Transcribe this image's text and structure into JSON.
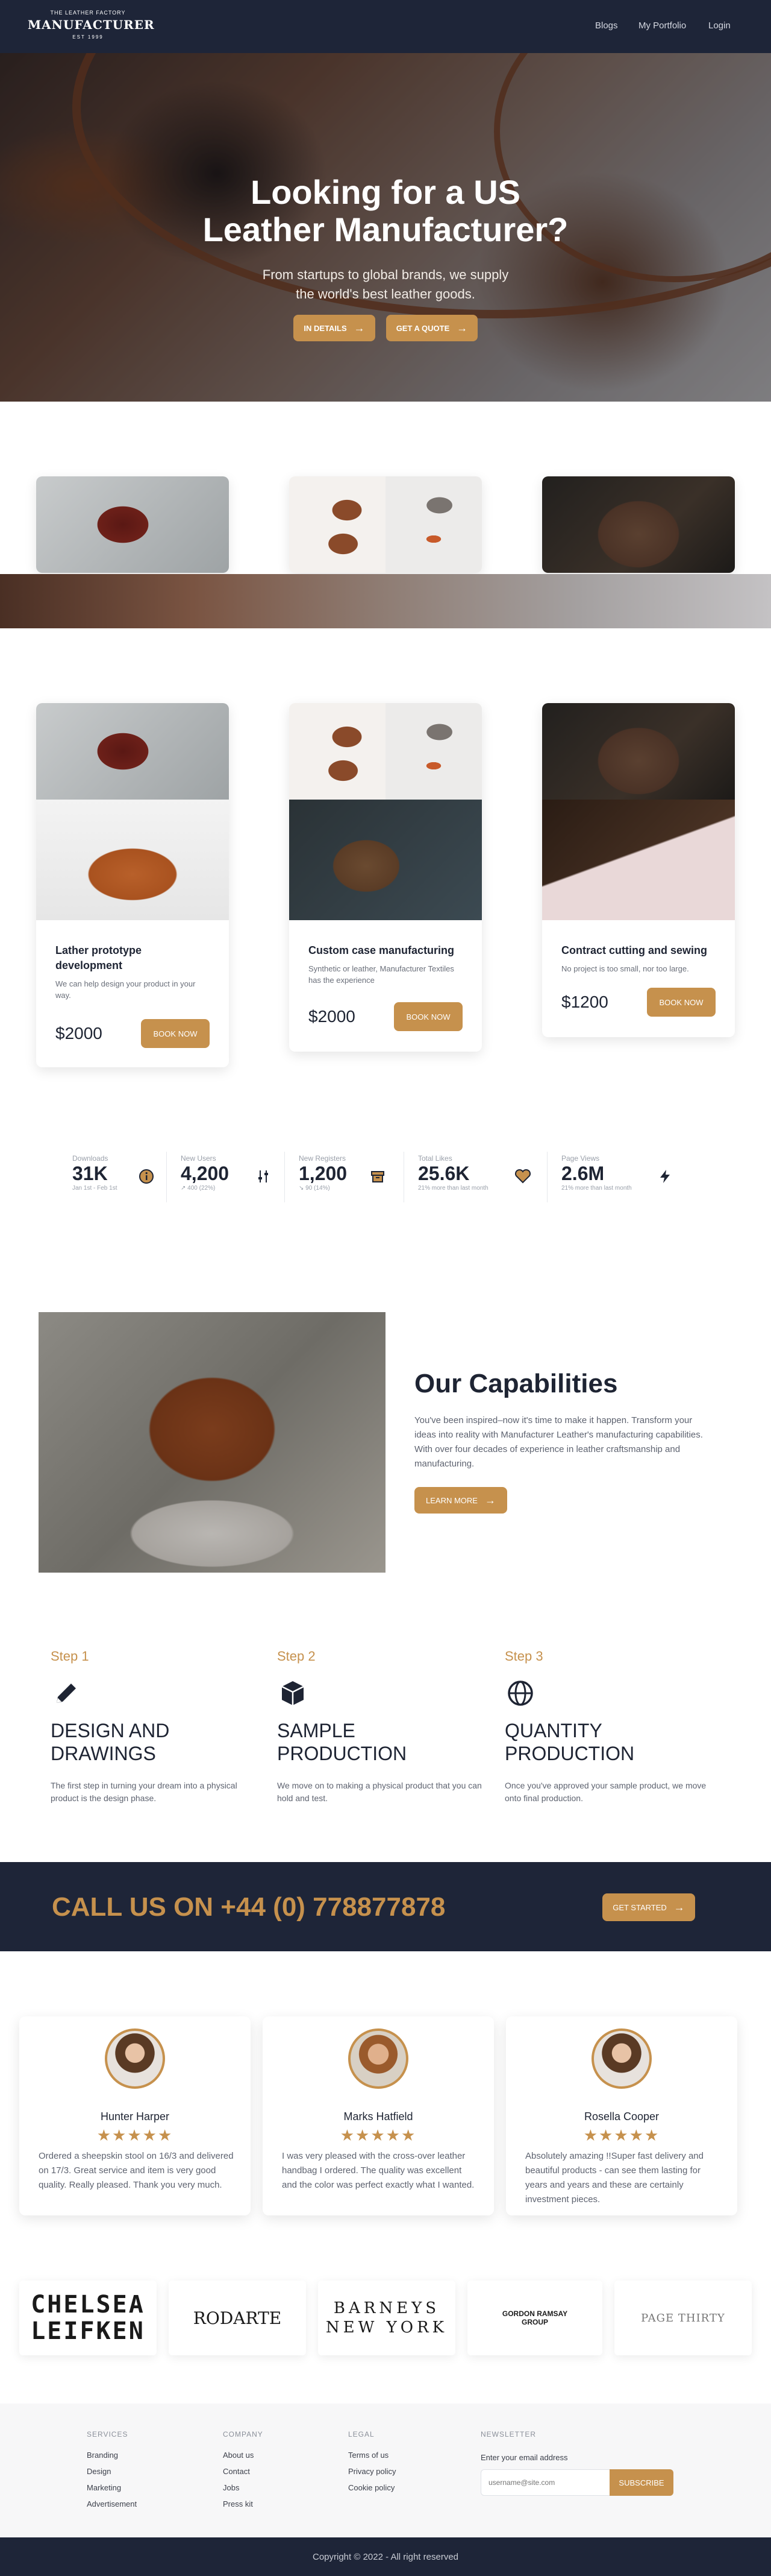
{
  "nav": {
    "logo_top": "THE LEATHER FACTORY",
    "logo_name": "MANUFACTURER",
    "logo_est": "EST 1999",
    "links": [
      "Blogs",
      "My Portfolio",
      "Login"
    ]
  },
  "hero": {
    "title_line1": "Looking for a US",
    "title_line2": "Leather Manufacturer?",
    "sub_line1": "From startups to global brands, we supply",
    "sub_line2": "the world's best leather goods.",
    "btn_details": "IN DETAILS",
    "btn_quote": "GET A QUOTE"
  },
  "products": [
    {
      "title": "Lather prototype development",
      "desc": "We can help design your product in your way.",
      "price": "$2000",
      "button": "BOOK NOW"
    },
    {
      "title": "Custom case manufacturing",
      "desc": "Synthetic or leather, Manufacturer Textiles has the experience",
      "price": "$2000",
      "button": "BOOK NOW"
    },
    {
      "title": "Contract cutting and sewing",
      "desc": "No project is too small, nor too large.",
      "price": "$1200",
      "button": "BOOK NOW"
    }
  ],
  "stats": [
    {
      "label": "Downloads",
      "value": "31K",
      "note": "Jan 1st - Feb 1st",
      "icon": "info-icon"
    },
    {
      "label": "New Users",
      "value": "4,200",
      "note": "↗ 400 (22%)",
      "icon": "sliders-icon"
    },
    {
      "label": "New Registers",
      "value": "1,200",
      "note": "↘ 90 (14%)",
      "icon": "archive-icon"
    },
    {
      "label": "Total Likes",
      "value": "25.6K",
      "note": "21% more than last month",
      "icon": "heart-icon"
    },
    {
      "label": "Page Views",
      "value": "2.6M",
      "note": "21% more than last month",
      "icon": "bolt-icon"
    }
  ],
  "capabilities": {
    "title": "Our Capabilities",
    "body": "You've been inspired–now it's time to make it happen. Transform your ideas into reality with Manufacturer Leather's manufacturing capabilities. With over four decades of experience in leather craftsmanship and manufacturing.",
    "button": "LEARN MORE"
  },
  "steps": [
    {
      "label": "Step 1",
      "title_line1": "DESIGN AND",
      "title_line2": "DRAWINGS",
      "desc": "The first step in turning your dream into a physical product is the design phase.",
      "icon": "pencil-icon"
    },
    {
      "label": "Step 2",
      "title_line1": "SAMPLE",
      "title_line2": "PRODUCTION",
      "desc": "We move on to making a physical product that you can hold and test.",
      "icon": "cube-icon"
    },
    {
      "label": "Step 3",
      "title_line1": "QUANTITY",
      "title_line2": "PRODUCTION",
      "desc": "Once you've approved your sample product, we move onto final production.",
      "icon": "globe-icon"
    }
  ],
  "call": {
    "text": "CALL US ON +44 (0) 778877878",
    "button": "GET STARTED"
  },
  "testimonials": [
    {
      "name": "Hunter Harper",
      "stars": "★★★★★",
      "text": "Ordered a sheepskin stool on 16/3 and delivered on 17/3. Great service and item is very good quality. Really pleased. Thank you very much."
    },
    {
      "name": "Marks Hatfield",
      "stars": "★★★★★",
      "text": "I was very pleased with the cross-over leather handbag I ordered. The quality was excellent and the color was perfect exactly what I wanted."
    },
    {
      "name": "Rosella Cooper",
      "stars": "★★★★★",
      "text": "Absolutely amazing !!Super fast delivery and beautiful products - can see them lasting for years and years and these are certainly investment pieces."
    }
  ],
  "brands": [
    {
      "line1": "CHELSEA",
      "line2": "LEIFKEN"
    },
    {
      "line1": "RODARTE",
      "line2": ""
    },
    {
      "line1": "BARNEYS",
      "line2": "NEW YORK"
    },
    {
      "line1": "GORDON RAMSAY",
      "line2": "GROUP"
    },
    {
      "line1": "PAGE THIRTY",
      "line2": ""
    }
  ],
  "footer": {
    "services": {
      "heading": "SERVICES",
      "links": [
        "Branding",
        "Design",
        "Marketing",
        "Advertisement"
      ]
    },
    "company": {
      "heading": "COMPANY",
      "links": [
        "About us",
        "Contact",
        "Jobs",
        "Press kit"
      ]
    },
    "legal": {
      "heading": "LEGAL",
      "links": [
        "Terms of us",
        "Privacy policy",
        "Cookie policy"
      ]
    },
    "newsletter": {
      "heading": "NEWSLETTER",
      "label": "Enter your email address",
      "placeholder": "username@site.com",
      "button": "SUBSCRIBE"
    },
    "copyright": "Copyright © 2022 - All right reserved"
  },
  "colors": {
    "navy": "#1e2538",
    "tan": "#c6914d"
  }
}
